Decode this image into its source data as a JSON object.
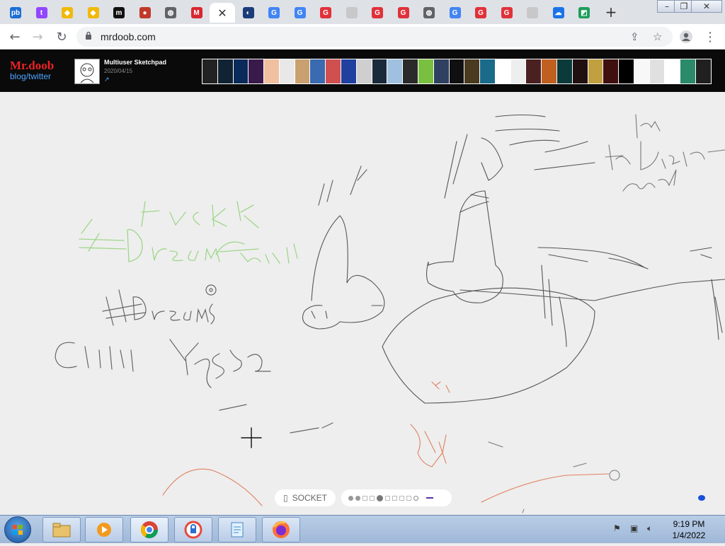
{
  "browser": {
    "tabs": [
      {
        "icon": "pb-icon",
        "glyph": "pb",
        "color": "#1b6fd6"
      },
      {
        "icon": "twitch-icon",
        "glyph": "t",
        "color": "#9146ff"
      },
      {
        "icon": "binance-icon",
        "glyph": "◆",
        "color": "#f0b90b"
      },
      {
        "icon": "binance-icon",
        "glyph": "◆",
        "color": "#f0b90b"
      },
      {
        "icon": "m-icon",
        "glyph": "m",
        "color": "#111111"
      },
      {
        "icon": "game-icon",
        "glyph": "●",
        "color": "#c0392b"
      },
      {
        "icon": "globe-icon",
        "glyph": "◍",
        "color": "#5f6368"
      },
      {
        "icon": "mega-icon",
        "glyph": "M",
        "color": "#d9272e"
      },
      {
        "icon": "close-icon",
        "glyph": "✕",
        "color": "#ffffff",
        "active": true
      },
      {
        "icon": "circle-icon",
        "glyph": "◐",
        "color": "#1a3c7a"
      },
      {
        "icon": "google-icon",
        "glyph": "G",
        "color": "#4285f4"
      },
      {
        "icon": "google-icon",
        "glyph": "G",
        "color": "#4285f4"
      },
      {
        "icon": "g-red-icon",
        "glyph": "G",
        "color": "#e0313a"
      },
      {
        "icon": "blank-icon",
        "glyph": "",
        "color": "#c8c8c8"
      },
      {
        "icon": "g-red-icon",
        "glyph": "G",
        "color": "#e0313a"
      },
      {
        "icon": "g-red-icon",
        "glyph": "G",
        "color": "#e0313a"
      },
      {
        "icon": "globe-icon",
        "glyph": "◍",
        "color": "#5f6368"
      },
      {
        "icon": "google-icon",
        "glyph": "G",
        "color": "#4285f4"
      },
      {
        "icon": "g-red-icon",
        "glyph": "G",
        "color": "#e0313a"
      },
      {
        "icon": "g-red-icon",
        "glyph": "G",
        "color": "#e0313a"
      },
      {
        "icon": "blank-icon",
        "glyph": "",
        "color": "#c8c8c8"
      },
      {
        "icon": "cloud-icon",
        "glyph": "☁",
        "color": "#1a73e8"
      },
      {
        "icon": "green-icon",
        "glyph": "◩",
        "color": "#1e9e5a"
      }
    ],
    "new_tab": "+",
    "window_controls": {
      "minimize": "–",
      "restore": "❐",
      "close": "✕"
    },
    "url": "mrdoob.com"
  },
  "site": {
    "logo_line1": "Mr.doob",
    "logo_line2": "blog/twitter",
    "post_title": "Multiuser Sketchpad",
    "post_date": "2020/04/15",
    "post_link_icon": "↗"
  },
  "canvas_ui": {
    "socket_label": "SOCKET",
    "socket_icon": "▯"
  },
  "taskbar": {
    "time": "9:19 PM",
    "date": "1/4/2022"
  }
}
